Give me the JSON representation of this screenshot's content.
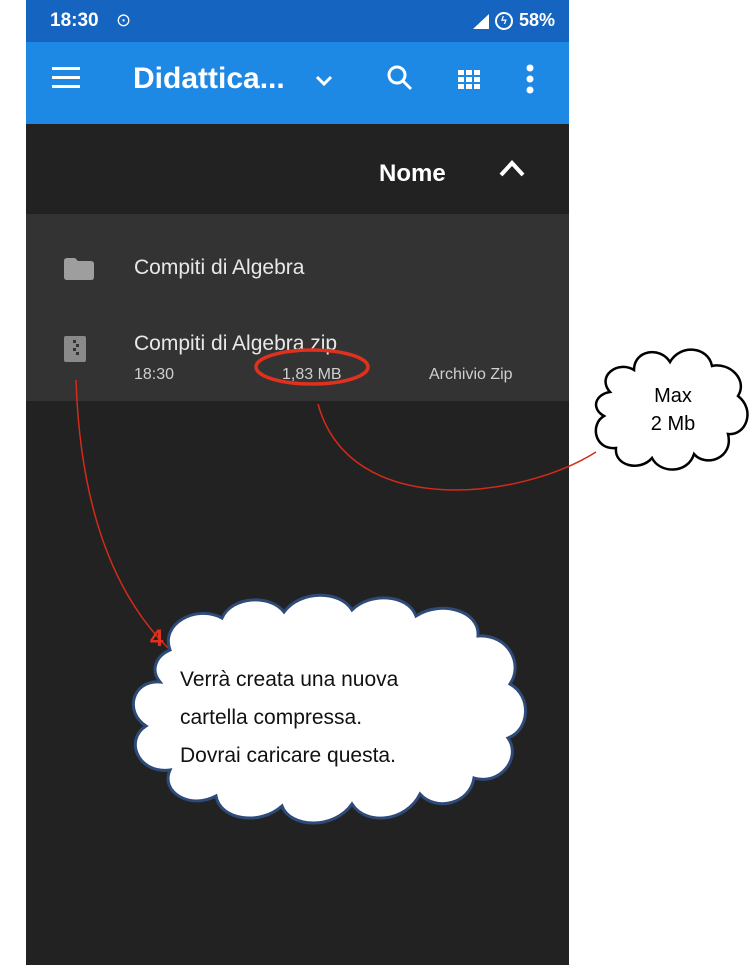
{
  "status_bar": {
    "time": "18:30",
    "battery": "58%"
  },
  "app_bar": {
    "title": "Didattica..."
  },
  "sort": {
    "label": "Nome"
  },
  "files": [
    {
      "name": "Compiti di Algebra",
      "type": "folder"
    },
    {
      "name": "Compiti di Algebra zip",
      "time": "18:30",
      "size": "1,83 MB",
      "kind": "Archivio Zip",
      "type": "zip"
    }
  ],
  "annotations": {
    "size_note": {
      "line1": "Max",
      "line2": "2 Mb"
    },
    "step_number": "4",
    "step_note": [
      "Verrà creata una nuova",
      "cartella compressa.",
      "Dovrai caricare questa."
    ]
  },
  "colors": {
    "status_bar": "#1565c0",
    "app_bar": "#1e88e5",
    "background": "#222222",
    "list": "#333333",
    "annotation_red": "#e0301e",
    "cloud_border": "#2e4a78"
  }
}
